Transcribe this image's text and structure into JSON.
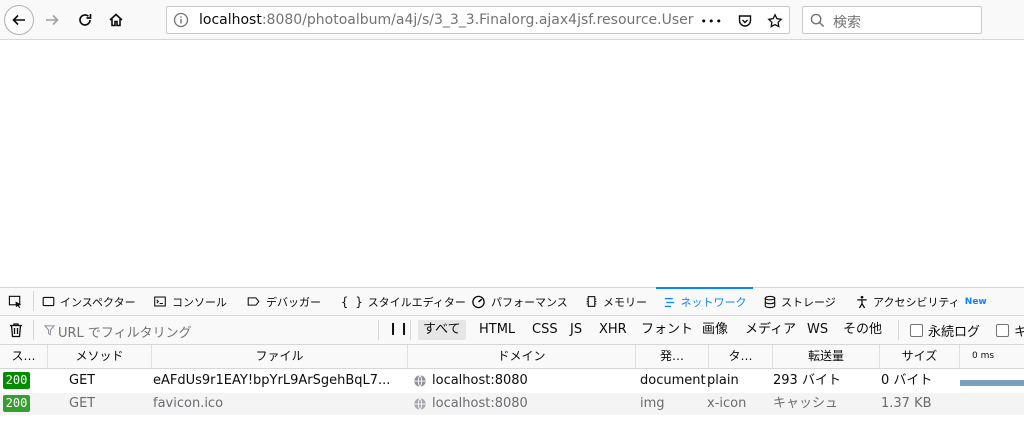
{
  "browser": {
    "url_host": "localhost",
    "url_rest": ":8080/photoalbum/a4j/s/3_3_3.Finalorg.ajax4jsf.resource.User",
    "search_placeholder": "検索",
    "overflow_glyph": "•••"
  },
  "devtools": {
    "tabs": [
      {
        "label": "インスペクター",
        "icon": "inspector-icon"
      },
      {
        "label": "コンソール",
        "icon": "console-icon"
      },
      {
        "label": "デバッガー",
        "icon": "debugger-icon"
      },
      {
        "label": "スタイルエディター",
        "icon": "style-editor-icon"
      },
      {
        "label": "パフォーマンス",
        "icon": "performance-icon"
      },
      {
        "label": "メモリー",
        "icon": "memory-icon"
      },
      {
        "label": "ネットワーク",
        "icon": "network-icon"
      },
      {
        "label": "ストレージ",
        "icon": "storage-icon"
      },
      {
        "label": "アクセシビリティ",
        "icon": "accessibility-icon"
      }
    ],
    "new_badge": "New",
    "style_editor_glyph": "{ }",
    "selected_tab": "ネットワーク",
    "filter": {
      "placeholder": "URL でフィルタリング",
      "pause_glyph": "❙❙",
      "types": [
        "すべて",
        "HTML",
        "CSS",
        "JS",
        "XHR",
        "フォント",
        "画像",
        "メディア",
        "WS",
        "その他"
      ],
      "active_type": "すべて",
      "persist_label": "永続ログ",
      "cache_label": "キ"
    },
    "columns": {
      "status": "ス…",
      "method": "メソッド",
      "file": "ファイル",
      "domain": "ドメイン",
      "cause": "発…",
      "type": "タ…",
      "transferred": "転送量",
      "size": "サイズ",
      "timeline": "0 ms"
    },
    "requests": [
      {
        "status": "200",
        "method": "GET",
        "file": "eAFdUs9r1EAY!bpYrL9ArSgehBqL7...",
        "domain": "localhost:8080",
        "cause": "document",
        "type": "plain",
        "transferred": "293 バイト",
        "size": "0 バイト"
      },
      {
        "status": "200",
        "method": "GET",
        "file": "favicon.ico",
        "domain": "localhost:8080",
        "cause": "img",
        "type": "x-icon",
        "transferred": "キャッシュ",
        "size": "1.37 KB"
      }
    ],
    "colors": {
      "accent": "#0a84ff",
      "status_ok": "#058b00",
      "waterfall": "#7b9fbf"
    }
  }
}
